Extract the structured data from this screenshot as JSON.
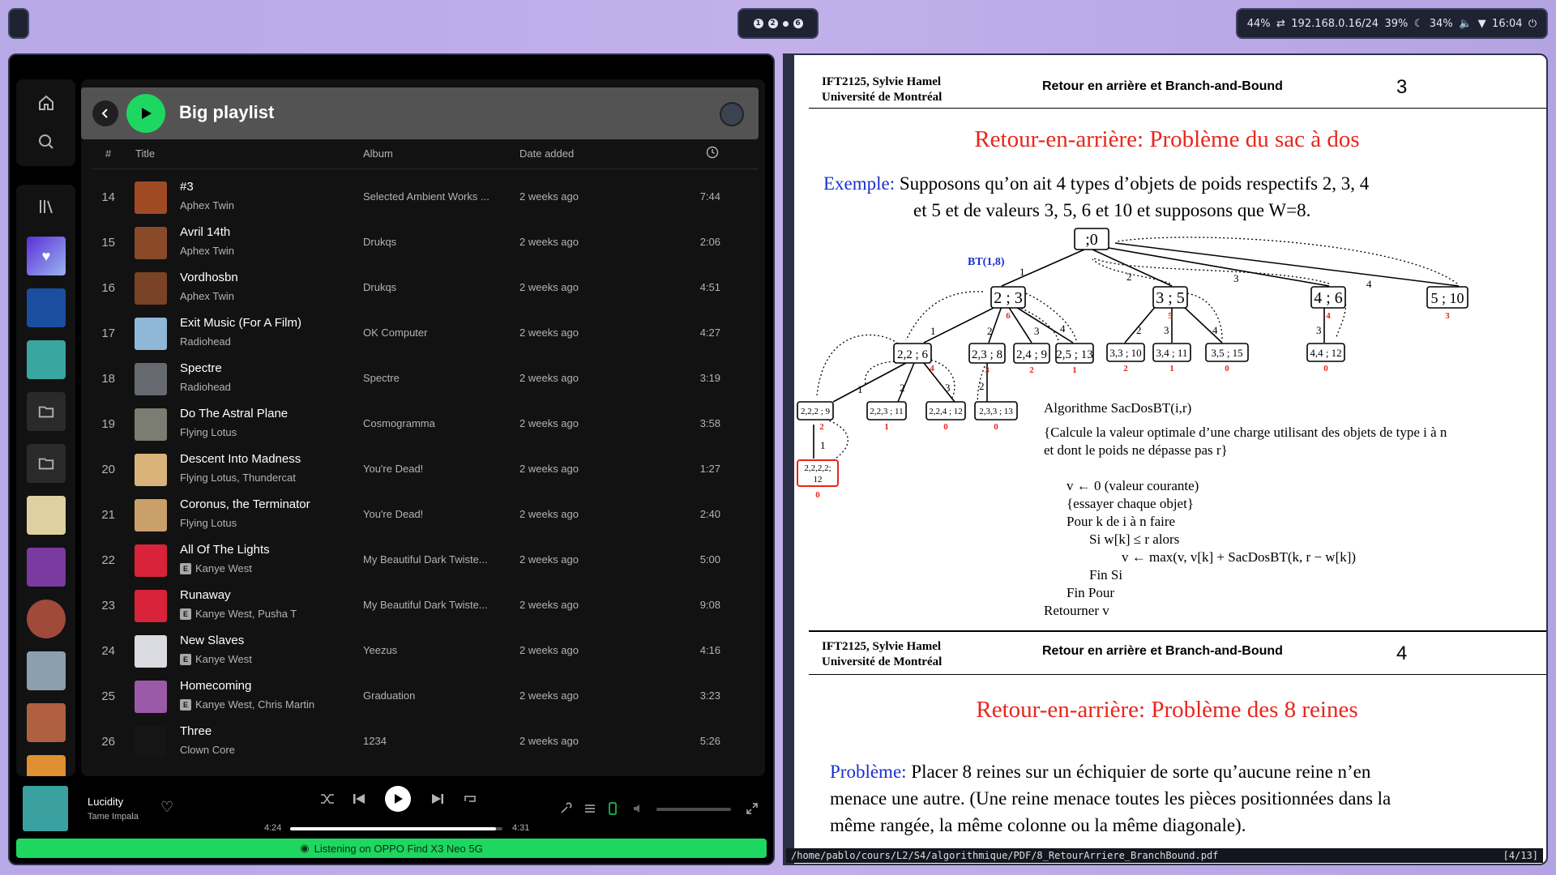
{
  "topbar": {
    "workspaces": [
      "1",
      "2",
      "",
      "6"
    ],
    "status": {
      "battery1": "44%",
      "ip": "192.168.0.16/24",
      "battery2": "39%",
      "battery3": "34%",
      "clock": "16:04"
    }
  },
  "spotify": {
    "playlist_title": "Big playlist",
    "columns": {
      "num": "#",
      "title": "Title",
      "album": "Album",
      "date": "Date added"
    },
    "tracks": [
      {
        "n": "14",
        "title": "#3",
        "artist": "Aphex Twin",
        "album": "Selected Ambient Works ...",
        "date": "2 weeks ago",
        "dur": "7:44",
        "explicit": false,
        "color": "#a04a24"
      },
      {
        "n": "15",
        "title": "Avril 14th",
        "artist": "Aphex Twin",
        "album": "Drukqs",
        "date": "2 weeks ago",
        "dur": "2:06",
        "explicit": false,
        "color": "#8a4a2a"
      },
      {
        "n": "16",
        "title": "Vordhosbn",
        "artist": "Aphex Twin",
        "album": "Drukqs",
        "date": "2 weeks ago",
        "dur": "4:51",
        "explicit": false,
        "color": "#7a4226"
      },
      {
        "n": "17",
        "title": "Exit Music (For A Film)",
        "artist": "Radiohead",
        "album": "OK Computer",
        "date": "2 weeks ago",
        "dur": "4:27",
        "explicit": false,
        "color": "#8fb7d6"
      },
      {
        "n": "18",
        "title": "Spectre",
        "artist": "Radiohead",
        "album": "Spectre",
        "date": "2 weeks ago",
        "dur": "3:19",
        "explicit": false,
        "color": "#666a70"
      },
      {
        "n": "19",
        "title": "Do The Astral Plane",
        "artist": "Flying Lotus",
        "album": "Cosmogramma",
        "date": "2 weeks ago",
        "dur": "3:58",
        "explicit": false,
        "color": "#7b7c72"
      },
      {
        "n": "20",
        "title": "Descent Into Madness",
        "artist": "Flying Lotus, Thundercat",
        "album": "You're Dead!",
        "date": "2 weeks ago",
        "dur": "1:27",
        "explicit": false,
        "color": "#d9b37a"
      },
      {
        "n": "21",
        "title": "Coronus, the Terminator",
        "artist": "Flying Lotus",
        "album": "You're Dead!",
        "date": "2 weeks ago",
        "dur": "2:40",
        "explicit": false,
        "color": "#c9a06a"
      },
      {
        "n": "22",
        "title": "All Of The Lights",
        "artist": "Kanye West",
        "album": "My Beautiful Dark Twiste...",
        "date": "2 weeks ago",
        "dur": "5:00",
        "explicit": true,
        "color": "#d8233a"
      },
      {
        "n": "23",
        "title": "Runaway",
        "artist": "Kanye West, Pusha T",
        "album": "My Beautiful Dark Twiste...",
        "date": "2 weeks ago",
        "dur": "9:08",
        "explicit": true,
        "color": "#d8233a"
      },
      {
        "n": "24",
        "title": "New Slaves",
        "artist": "Kanye West",
        "album": "Yeezus",
        "date": "2 weeks ago",
        "dur": "4:16",
        "explicit": true,
        "color": "#d9dbe0"
      },
      {
        "n": "25",
        "title": "Homecoming",
        "artist": "Kanye West, Chris Martin",
        "album": "Graduation",
        "date": "2 weeks ago",
        "dur": "3:23",
        "explicit": true,
        "color": "#9a5aa8"
      },
      {
        "n": "26",
        "title": "Three",
        "artist": "Clown Core",
        "album": "1234",
        "date": "2 weeks ago",
        "dur": "5:26",
        "explicit": false,
        "color": "#151515"
      }
    ],
    "library_colors": [
      "#1a4fa0",
      "#3aa6a0",
      "#e0cfa0",
      "#7a3aa0",
      "#a04a3a",
      "#8aa0b0",
      "#b06040",
      "#e09030"
    ],
    "now_playing": {
      "title": "Lucidity",
      "artist": "Tame Impala",
      "elapsed": "4:24",
      "total": "4:31",
      "progress": 0.97,
      "art_color": "#3aa0a0"
    },
    "device_bar": "Listening on OPPO Find X3 Neo 5G"
  },
  "pdf": {
    "page3": {
      "header_left_1": "IFT2125,  Sylvie Hamel",
      "header_left_2": "Université de Montréal",
      "header_center": "Retour en arrière et Branch-and-Bound",
      "page_num": "3",
      "title": "Retour-en-arrière: Problème du sac à dos",
      "example_label": "Exemple:",
      "example_line1": "Supposons qu’on ait 4 types d’objets de poids respectifs 2, 3, 4",
      "example_line2": "et 5 et de valeurs 3, 5, 6 et 10 et supposons que W=8.",
      "tree_label": "BT(1,8)",
      "nodes": {
        "root": ";0",
        "n23": "2 ; 3",
        "n35": "3 ; 5",
        "n46": "4 ; 6",
        "n510": "5 ; 10",
        "n226": "2,2 ; 6",
        "n238": "2,3 ; 8",
        "n249": "2,4 ; 9",
        "n2513": "2,5 ; 13",
        "n3310": "3,3 ; 10",
        "n3411": "3,4 ; 11",
        "n3515": "3,5 ; 15",
        "n4412": "4,4 ; 12",
        "n2229": "2,2,2 ; 9",
        "n22311": "2,2,3 ; 11",
        "n22412": "2,2,4 ; 12",
        "n23313": "2,3,3 ; 13",
        "n2222a": "2,2,2,2;",
        "n2222b": "12"
      },
      "algo": [
        "Algorithme SacDosBT(i,r)",
        "{Calcule la valeur optimale d’une charge utilisant des objets de type i à n",
        "et dont le poids ne dépasse pas r}",
        "v ← 0 (valeur courante)",
        "{essayer chaque objet}",
        "Pour k de i à n faire",
        "Si w[k] ≤ r alors",
        "v ← max(v, v[k] + SacDosBT(k, r − w[k])",
        "Fin Si",
        "Fin Pour",
        "Retourner v"
      ]
    },
    "page4": {
      "header_left_1": "IFT2125,  Sylvie Hamel",
      "header_left_2": "Université de Montréal",
      "header_center": "Retour en arrière et Branch-and-Bound",
      "page_num": "4",
      "title": "Retour-en-arrière: Problème des 8 reines",
      "problem_label": "Problème:",
      "problem_line1": "Placer 8 reines sur un échiquier de sorte qu’aucune reine n’en",
      "problem_line2": "menace une autre. (Une reine menace toutes les pièces positionnées dans la",
      "problem_line3": "même rangée, la même colonne ou la même diagonale)."
    },
    "statusbar": {
      "path": "/home/pablo/cours/L2/S4/algorithmique/PDF/8_RetourArriere_BranchBound.pdf",
      "page": "[4/13]"
    }
  }
}
